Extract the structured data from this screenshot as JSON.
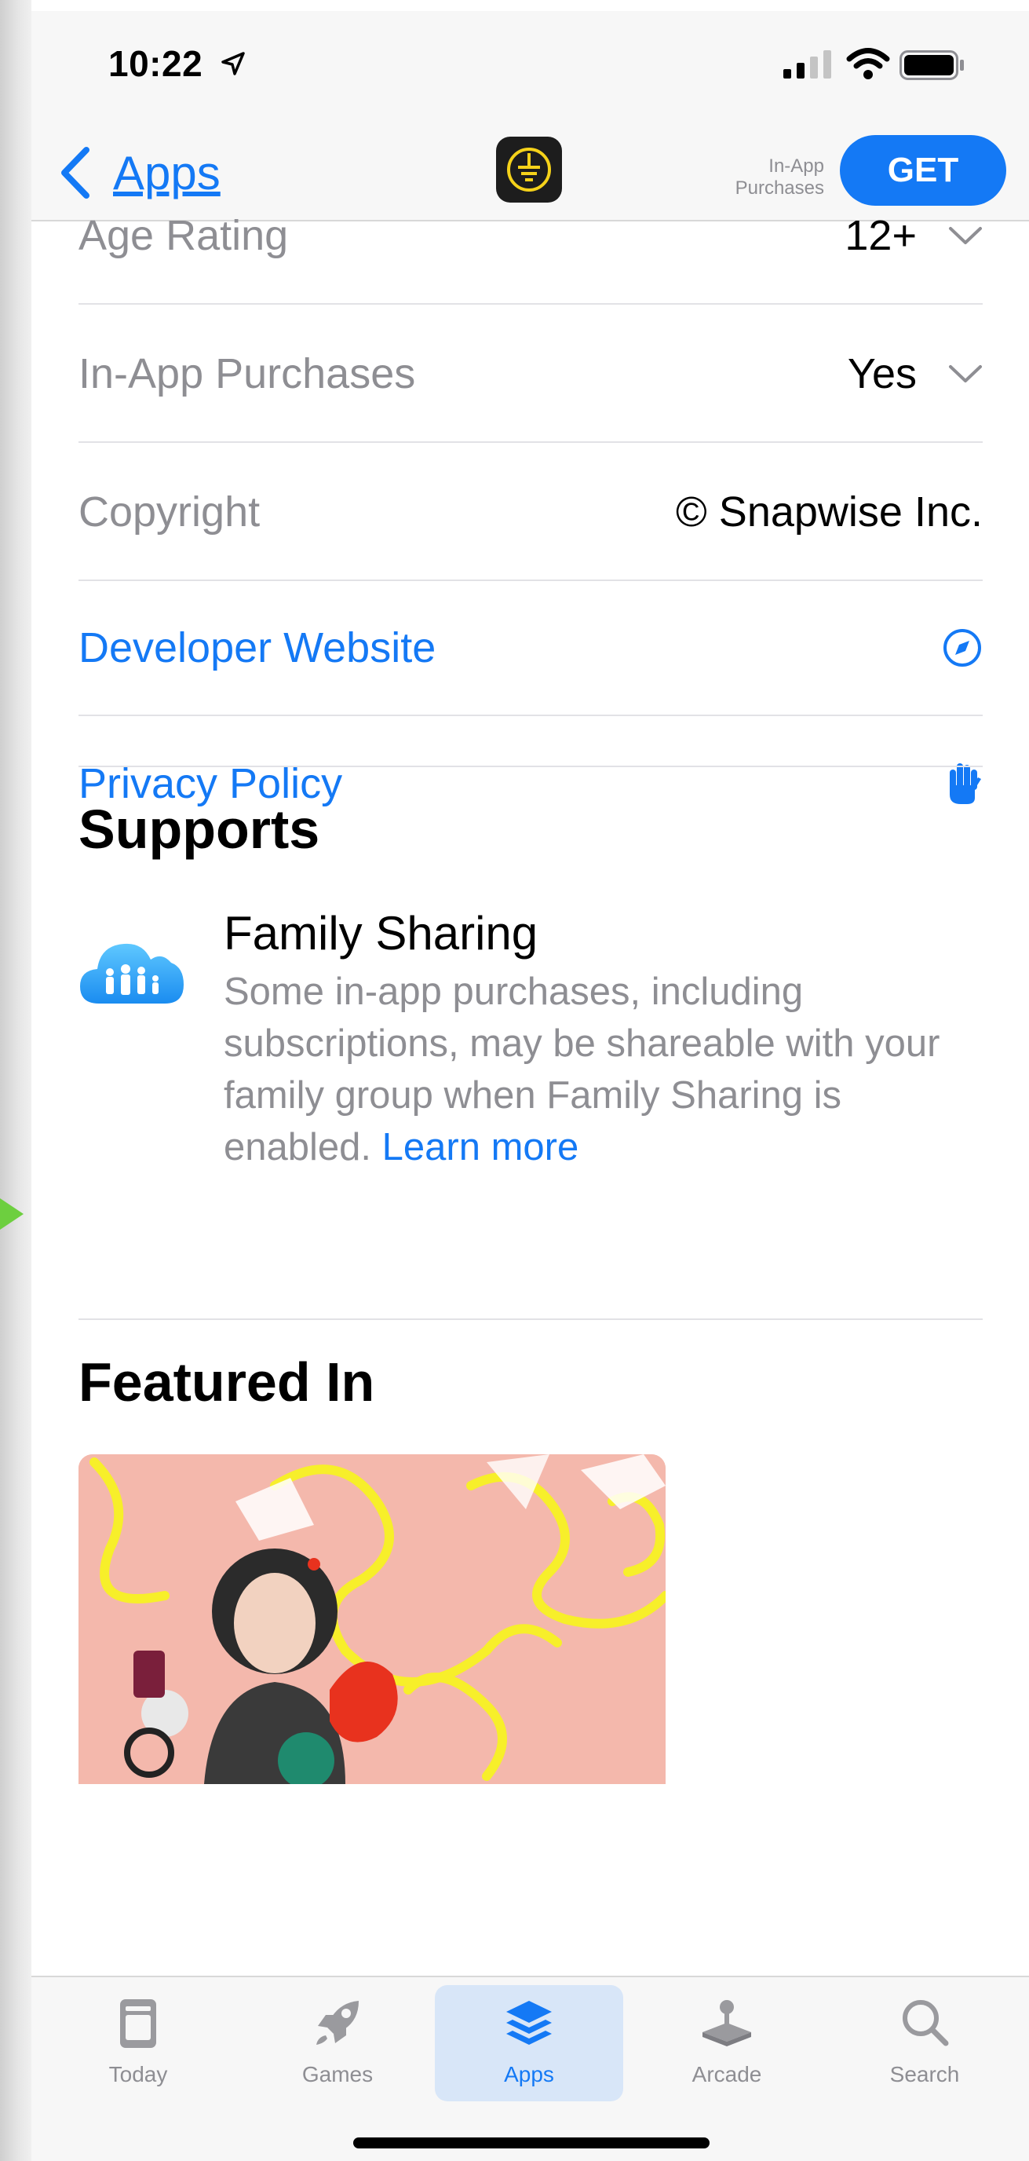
{
  "status_bar": {
    "time": "10:22"
  },
  "nav": {
    "back_label": "Apps",
    "iap_label": "In-App Purchases",
    "get_label": "GET"
  },
  "info_rows": [
    {
      "label": "Age Rating",
      "value": "12+"
    },
    {
      "label": "In-App Purchases",
      "value": "Yes"
    },
    {
      "label": "Copyright",
      "value": "© Snapwise Inc."
    }
  ],
  "links": [
    {
      "label": "Developer Website",
      "icon": "compass-icon"
    },
    {
      "label": "Privacy Policy",
      "icon": "hand-icon"
    }
  ],
  "supports": {
    "title": "Supports",
    "family_sharing": {
      "title": "Family Sharing",
      "description": "Some in-app purchases, including subscriptions, may be shareable with your family group when Family Sharing is enabled.",
      "learn_more": "Learn more"
    }
  },
  "featured": {
    "title": "Featured In"
  },
  "tab_bar": {
    "tabs": [
      {
        "label": "Today",
        "icon": "today-icon",
        "active": false
      },
      {
        "label": "Games",
        "icon": "rocket-icon",
        "active": false
      },
      {
        "label": "Apps",
        "icon": "layers-icon",
        "active": true
      },
      {
        "label": "Arcade",
        "icon": "joystick-icon",
        "active": false
      },
      {
        "label": "Search",
        "icon": "search-icon",
        "active": false
      }
    ]
  },
  "colors": {
    "accent": "#1479f5",
    "secondary_text": "#8e8e93",
    "bar_background": "#f7f7f7",
    "active_tab_background": "#d8e6f8",
    "app_icon_background": "#1d1d1d",
    "app_icon_symbol": "#f5d21a",
    "featured_card_background": "#f4b8ac"
  }
}
